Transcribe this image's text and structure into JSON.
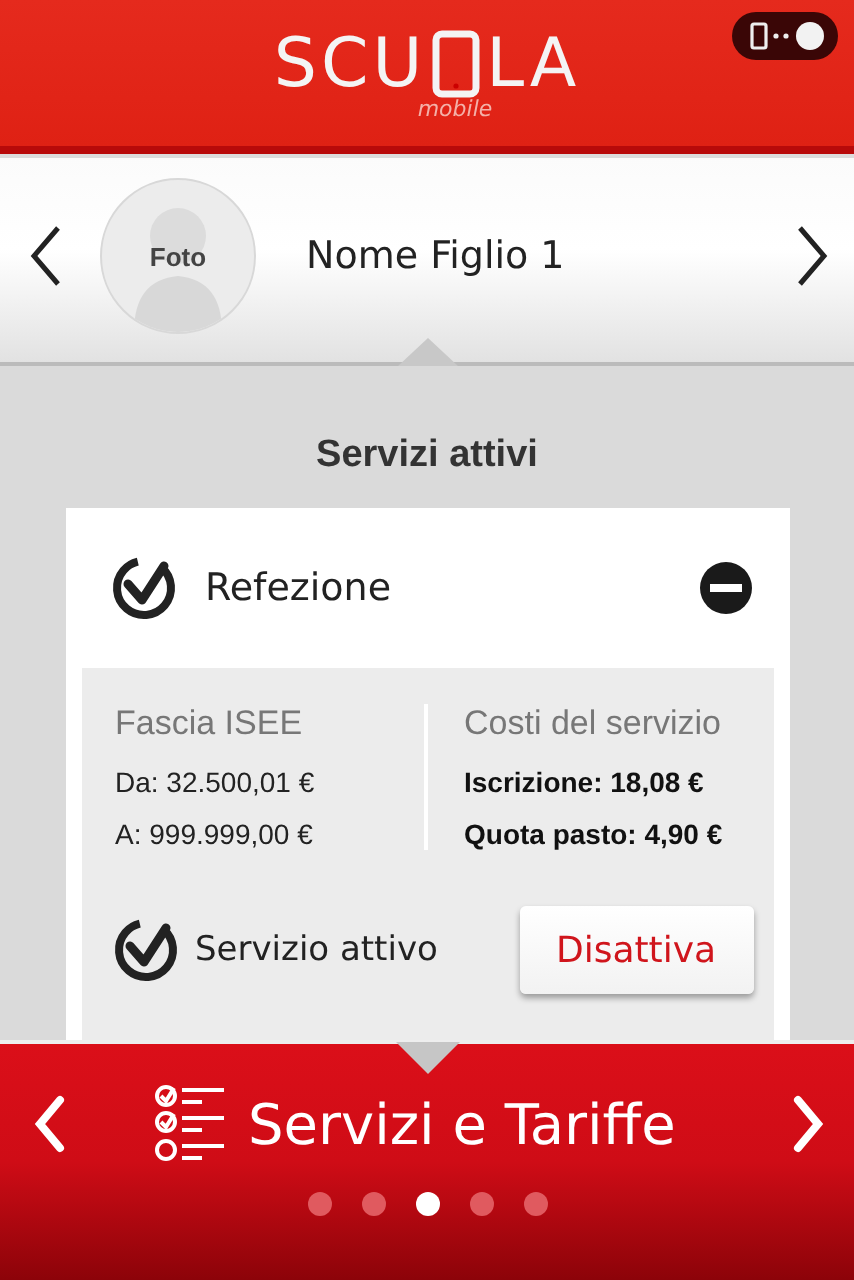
{
  "header": {
    "logo_left": "SCU",
    "logo_right": "LA",
    "logo_sub": "mobile"
  },
  "child": {
    "photo_label": "Foto",
    "name": "Nome Figlio 1"
  },
  "section_title": "Servizi attivi",
  "service": {
    "name": "Refezione",
    "expanded": true,
    "active": true,
    "isee_title": "Fascia ISEE",
    "isee_from": "Da: 32.500,01 €",
    "isee_to": "A: 999.999,00 €",
    "costs_title": "Costi del servizio",
    "cost_lines": [
      "Iscrizione: 18,08 €",
      "Quota pasto: 4,90 €"
    ],
    "status_label": "Servizio attivo",
    "action_button": "Disattiva"
  },
  "bottom_nav": {
    "title": "Servizi e Tariffe",
    "pages": [
      {
        "selected": false
      },
      {
        "selected": false
      },
      {
        "selected": true
      },
      {
        "selected": false
      },
      {
        "selected": false
      }
    ]
  }
}
